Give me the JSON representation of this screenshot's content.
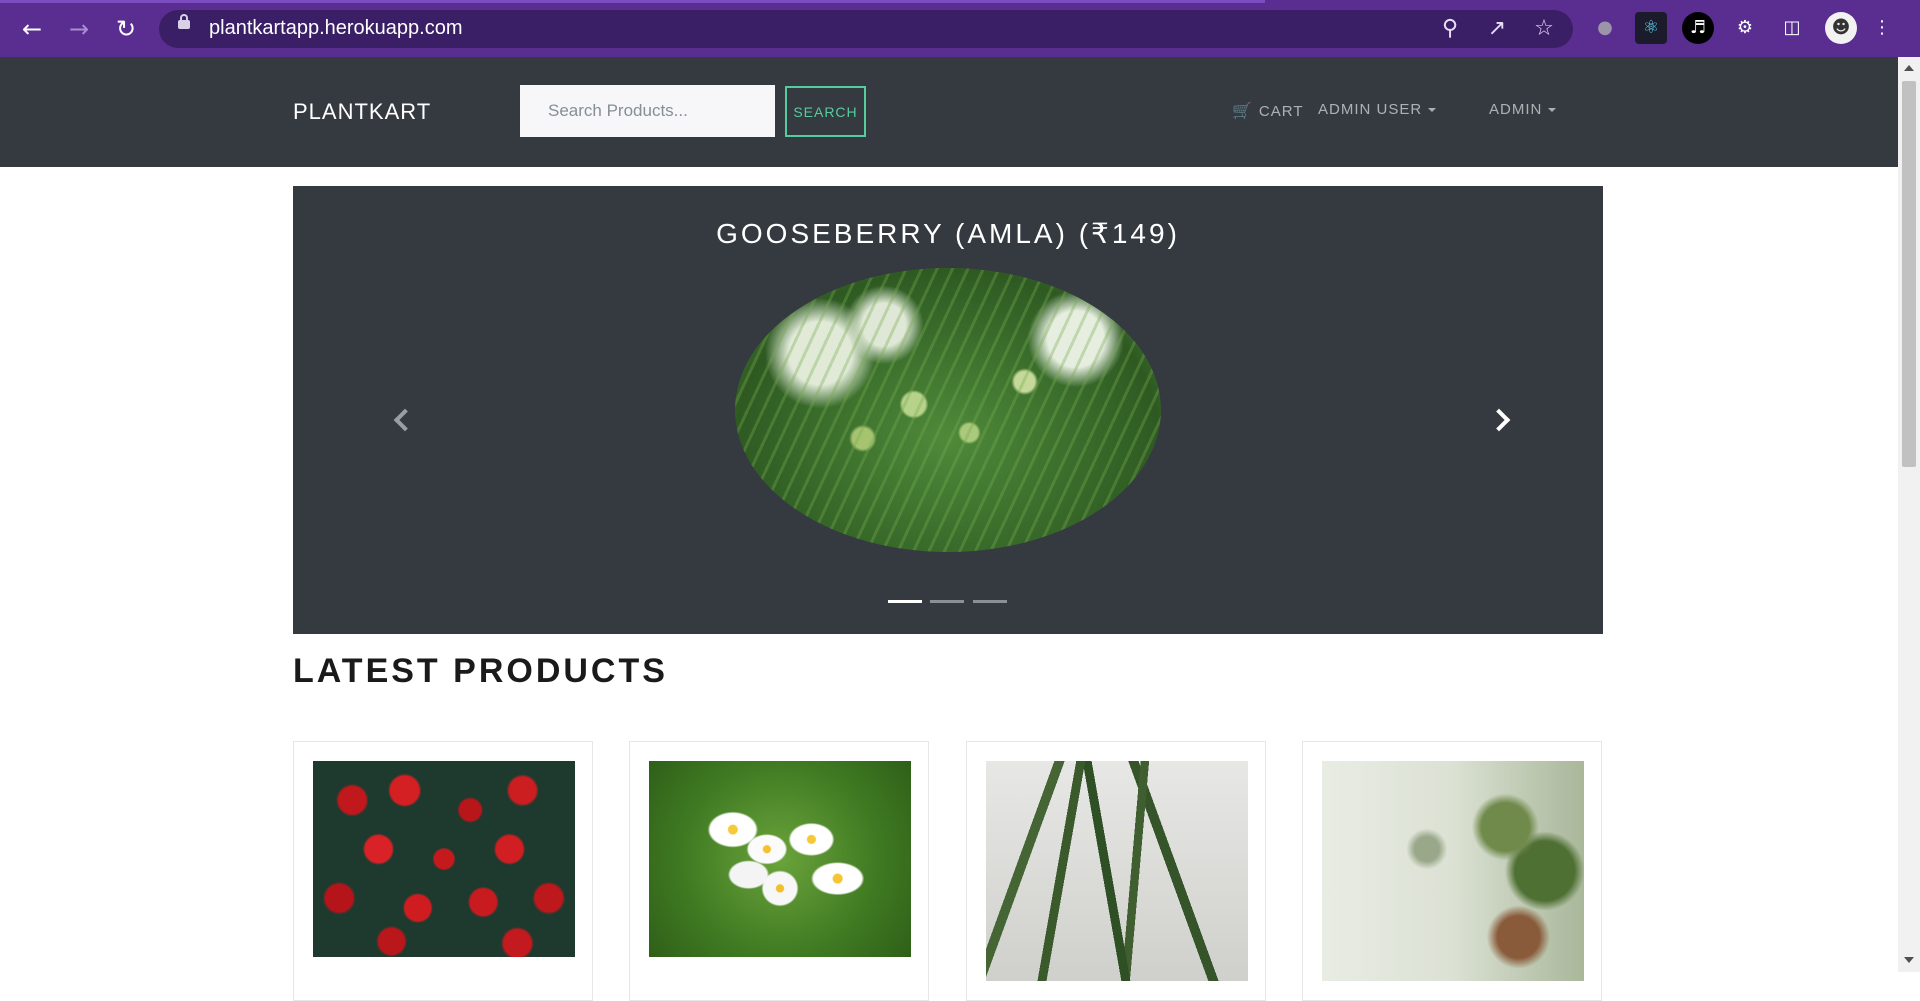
{
  "browser": {
    "url": "plantkartapp.herokuapp.com",
    "icons": [
      "back-icon",
      "forward-icon",
      "reload-icon",
      "lock-icon",
      "zoom-icon",
      "share-icon",
      "bookmark-star-icon",
      "extension-icon",
      "react-devtools-icon",
      "audio-extension-icon",
      "puzzle-extensions-icon",
      "side-panel-icon",
      "profile-avatar-icon",
      "menu-kebab-icon"
    ]
  },
  "header": {
    "brand": "PLANTKART",
    "search_placeholder": "Search Products...",
    "search_button": "SEARCH",
    "cart_label": "CART",
    "user_menu_label": "ADMIN USER",
    "admin_menu_label": "ADMIN"
  },
  "carousel": {
    "title": "GOOSEBERRY (AMLA) (₹149)",
    "active_index": 0,
    "slide_count": 3
  },
  "latest": {
    "title": "LATEST PRODUCTS",
    "products": [
      {
        "image": "red-roses"
      },
      {
        "image": "white-jasmine-flowers"
      },
      {
        "image": "snake-plant"
      },
      {
        "image": "herb-plants"
      }
    ]
  },
  "colors": {
    "chrome": "#5a2d91",
    "navbar": "#343a40",
    "accent": "#56cc9d"
  }
}
